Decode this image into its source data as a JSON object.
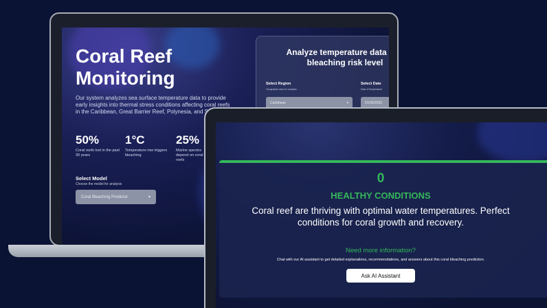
{
  "laptop": {
    "hero_title": "Coral Reef Monitoring",
    "hero_desc": "Our system analyzes sea surface temperature data to provide early insights into thermal stress conditions affecting coral reefs in the Caribbean, Great Barrier Reef, Polynesia, and So",
    "stats": [
      {
        "value": "50%",
        "label": "Coral reefs lost in the past 30 years"
      },
      {
        "value": "1°C",
        "label": "Temperature rise triggers bleaching"
      },
      {
        "value": "25%",
        "label": "Marine species depend on coral reefs"
      }
    ],
    "model": {
      "title": "Select Model",
      "subtitle": "Choose the model for analysis",
      "selected": "Coral Bleaching Predictor"
    },
    "panel": {
      "title": "Analyze temperature data to a bleaching risk level",
      "region_label": "Select Region",
      "region_sub": "Geographic area for analysis",
      "region_value": "Caribbean",
      "date_label": "Select Date",
      "date_sub": "Date of temperature",
      "date_value": "01/06/2025"
    }
  },
  "tablet": {
    "result_value": "0",
    "result_status": "HEALTHY CONDITIONS",
    "result_desc": "Coral reef are thriving with optimal water temperatures. Perfect conditions for coral growth and recovery.",
    "info_title": "Need more information?",
    "info_sub": "Chat with our AI assistant to get detailed explanations, recommendations, and answers about this coral bleaching prediction.",
    "ask_button": "Ask AI Assistant"
  },
  "colors": {
    "background": "#0a1333",
    "accent_green": "#35b85a"
  }
}
